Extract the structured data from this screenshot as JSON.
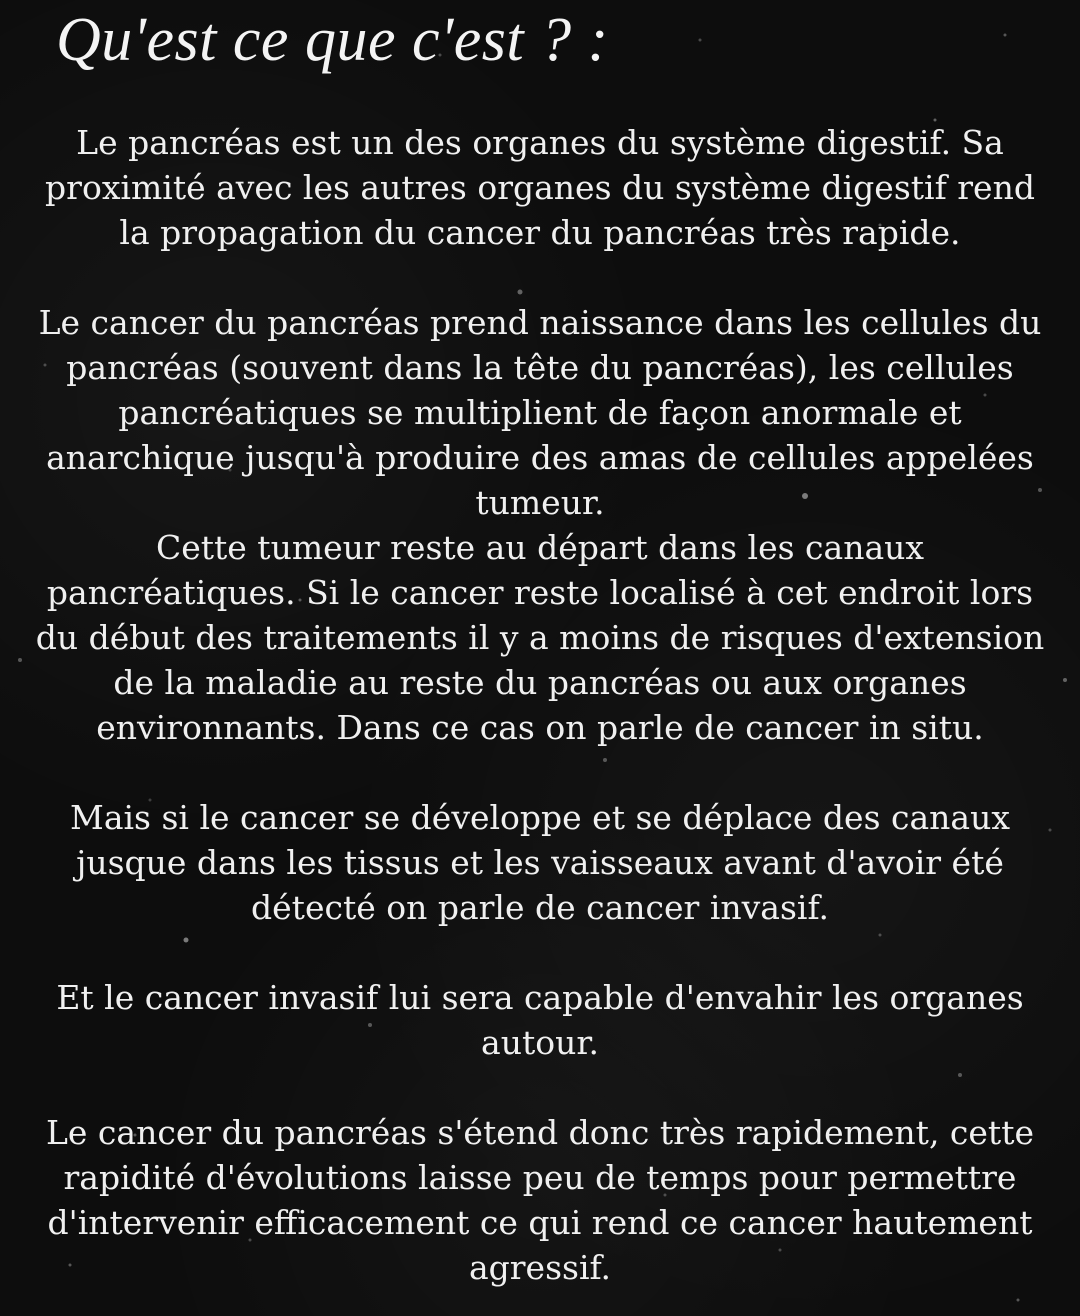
{
  "title": "Qu'est ce que c'est ? :",
  "paragraphs": [
    {
      "lines": [
        "Le pancréas est un des organes du système digestif. Sa",
        "proximité avec les autres organes du système digestif rend",
        "la propagation du cancer du pancréas très rapide."
      ]
    },
    {
      "lines": [
        "Le cancer du pancréas prend naissance dans les cellules du",
        "pancréas (souvent dans la tête du pancréas), les cellules",
        "pancréatiques se multiplient de façon anormale et",
        "anarchique jusqu'à produire des amas de cellules appelées",
        "tumeur."
      ]
    },
    {
      "lines": [
        "Cette tumeur reste au départ dans les canaux",
        "pancréatiques. Si le cancer reste localisé à cet endroit lors",
        "du début des traitements il y a moins de risques d'extension",
        "de la maladie au reste du pancréas ou aux organes",
        "environnants. Dans ce cas on parle de cancer in situ."
      ]
    },
    {
      "lines": [
        "Mais si le cancer se développe et se déplace des canaux",
        "jusque dans les tissus et les vaisseaux avant d'avoir été",
        "détecté on parle de cancer invasif."
      ]
    },
    {
      "lines": [
        "Et le cancer invasif lui sera capable d'envahir les organes",
        "autour."
      ]
    },
    {
      "lines": [
        "Le cancer du pancréas s'étend donc très rapidement, cette",
        "rapidité d'évolutions laisse peu de temps pour permettre",
        "d'intervenir efficacement ce qui rend ce cancer hautement",
        "agressif."
      ]
    }
  ],
  "colors": {
    "background": "#0d0d0d",
    "text": "#f0f0f0"
  }
}
